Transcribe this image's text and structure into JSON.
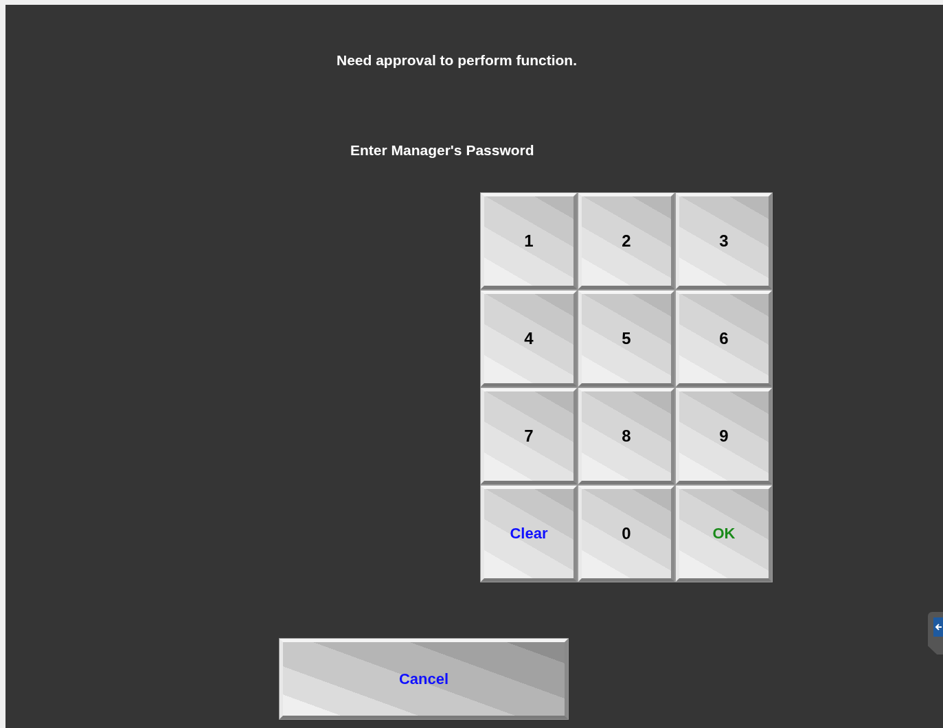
{
  "message": "Need approval to perform function.",
  "prompt": "Enter Manager's Password",
  "keypad": [
    {
      "label": "1",
      "kind": "digit"
    },
    {
      "label": "2",
      "kind": "digit"
    },
    {
      "label": "3",
      "kind": "digit"
    },
    {
      "label": "4",
      "kind": "digit"
    },
    {
      "label": "5",
      "kind": "digit"
    },
    {
      "label": "6",
      "kind": "digit"
    },
    {
      "label": "7",
      "kind": "digit"
    },
    {
      "label": "8",
      "kind": "digit"
    },
    {
      "label": "9",
      "kind": "digit"
    },
    {
      "label": "Clear",
      "kind": "clear"
    },
    {
      "label": "0",
      "kind": "digit"
    },
    {
      "label": "OK",
      "kind": "ok"
    }
  ],
  "cancel_button": "Cancel"
}
